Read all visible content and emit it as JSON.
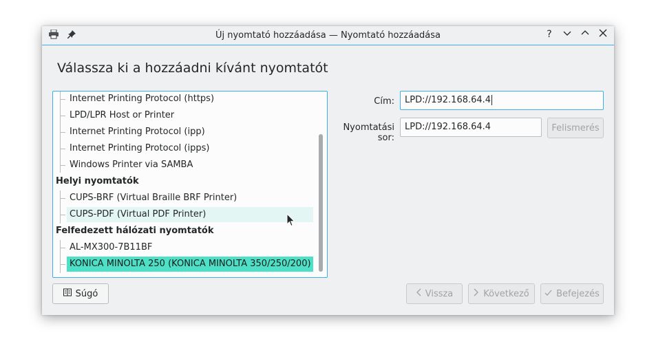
{
  "window": {
    "title": "Új nyomtató hozzáadása — Nyomtató hozzáadása",
    "buttons": {
      "help": "?",
      "minimize": "⌄",
      "maximize": "⌃",
      "close": "✕"
    }
  },
  "heading": "Válassza ki a hozzáadni kívánt nyomtatót",
  "tree": {
    "items": [
      {
        "label": "Internet Printing Protocol (https)",
        "kind": "child"
      },
      {
        "label": "LPD/LPR Host or Printer",
        "kind": "child"
      },
      {
        "label": "Internet Printing Protocol (ipp)",
        "kind": "child"
      },
      {
        "label": "Internet Printing Protocol (ipps)",
        "kind": "child"
      },
      {
        "label": "Windows Printer via SAMBA",
        "kind": "child"
      },
      {
        "label": "Helyi nyomtatók",
        "kind": "group"
      },
      {
        "label": "CUPS-BRF (Virtual Braille BRF Printer)",
        "kind": "child"
      },
      {
        "label": "CUPS-PDF (Virtual PDF Printer)",
        "kind": "child",
        "state": "hover"
      },
      {
        "label": "Felfedezett hálózati nyomtatók",
        "kind": "group"
      },
      {
        "label": "AL-MX300-7B11BF",
        "kind": "child"
      },
      {
        "label": "KONICA MINOLTA 250 (KONICA MINOLTA 350/250/200)",
        "kind": "child",
        "state": "selected"
      }
    ]
  },
  "form": {
    "address_label": "Cím:",
    "address_value": "LPD://192.168.64.4",
    "queue_label": "Nyomtatási sor:",
    "queue_value": "LPD://192.168.64.4",
    "probe_button": "Felismerés"
  },
  "footer": {
    "help_button": "Súgó",
    "back_button": "Vissza",
    "next_button": "Következő",
    "finish_button": "Befejezés"
  },
  "colors": {
    "accent": "#3daee9",
    "selection": "#4de0c6",
    "hover": "#e3f6f4"
  }
}
